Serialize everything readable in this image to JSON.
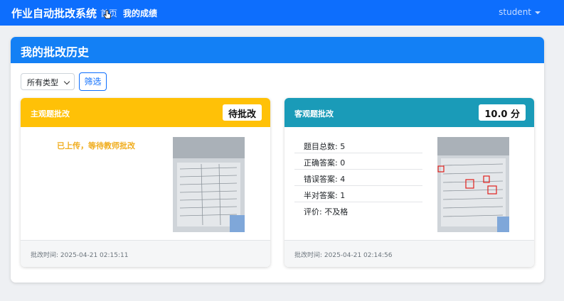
{
  "navbar": {
    "brand": "作业自动批改系统",
    "home_label": "首页",
    "grades_label": "我的成绩",
    "user_label": "student"
  },
  "panel": {
    "title": "我的批改历史",
    "filter": {
      "selected": "所有类型",
      "button_label": "筛选"
    }
  },
  "cards": [
    {
      "title": "主观题批改",
      "badge": "待批改",
      "message": "已上传，等待教师批改",
      "footer": "批改时间: 2025-04-21 02:15:11"
    },
    {
      "title": "客观题批改",
      "badge": "10.0 分",
      "stats": [
        "题目总数: 5",
        "正确答案: 0",
        "错误答案: 4",
        "半对答案: 1",
        "评价: 不及格"
      ],
      "footer": "批改时间: 2025-04-21 02:14:56"
    }
  ],
  "colors": {
    "primary": "#0d6efd",
    "warning": "#ffc107",
    "info": "#1a9bb8"
  }
}
